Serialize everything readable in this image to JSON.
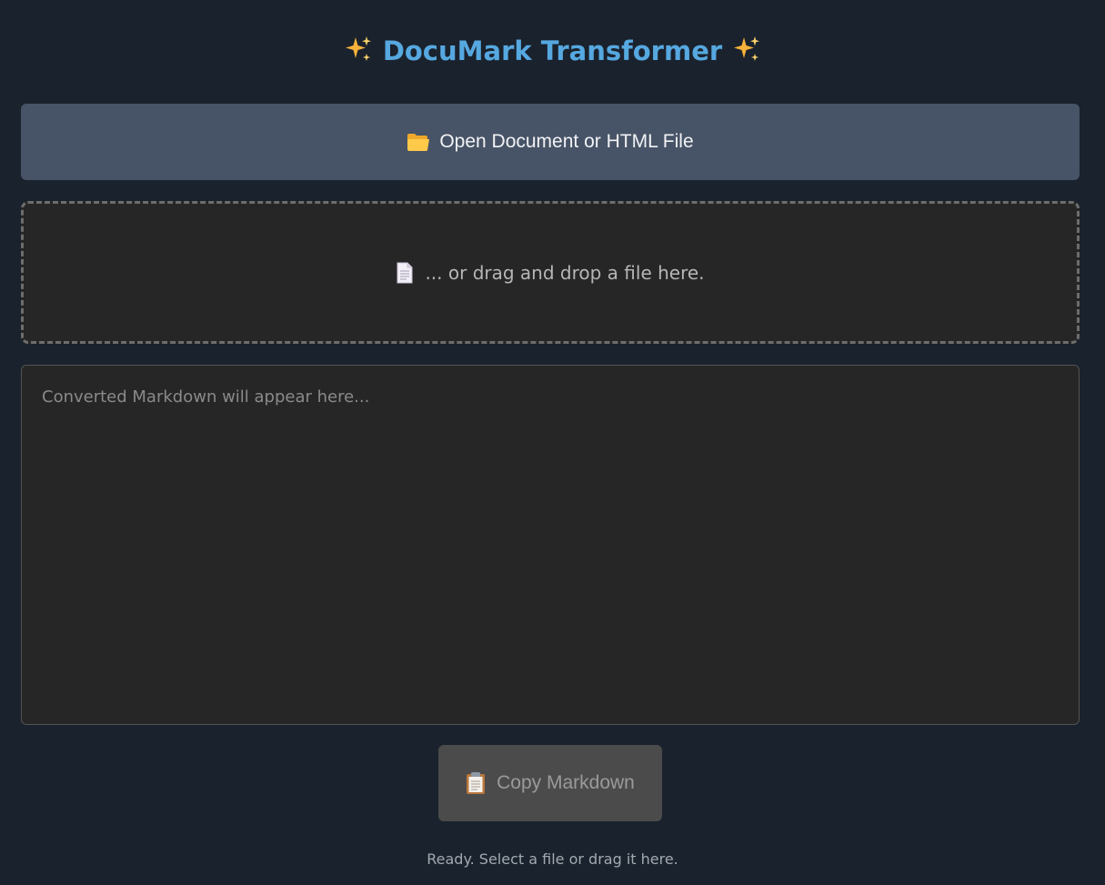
{
  "header": {
    "title": "DocuMark Transformer",
    "left_icon": "sparkles-icon",
    "right_icon": "sparkles-icon"
  },
  "open_button": {
    "label": "Open Document or HTML File",
    "icon": "folder-icon"
  },
  "drop_zone": {
    "label": "... or drag and drop a file here.",
    "icon": "document-icon"
  },
  "output": {
    "value": "",
    "placeholder": "Converted Markdown will appear here..."
  },
  "copy_button": {
    "label": "Copy Markdown",
    "icon": "clipboard-icon",
    "enabled": false
  },
  "status": {
    "text": "Ready. Select a file or drag it here."
  },
  "colors": {
    "background": "#1a222d",
    "title": "#56a8e0",
    "open_button_bg": "#475366",
    "panel_bg": "#262626",
    "copy_button_bg": "#4b4b4b"
  }
}
